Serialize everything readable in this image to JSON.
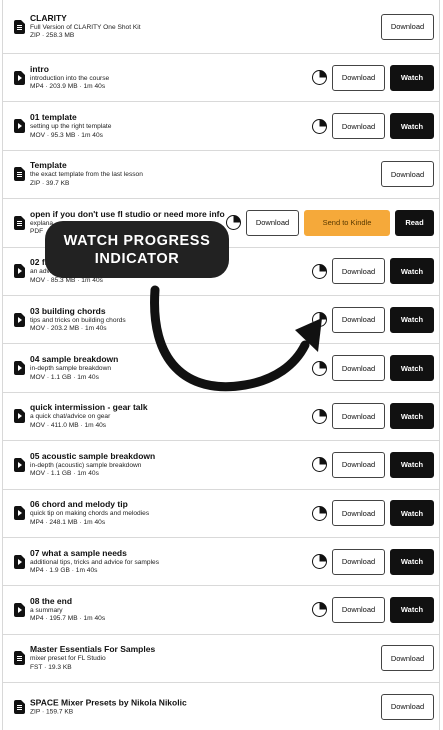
{
  "buttons": {
    "download": "Download",
    "watch": "Watch",
    "send_to_kindle": "Send to Kindle",
    "read": "Read"
  },
  "annotation": {
    "line1": "WATCH PROGRESS",
    "line2": "INDICATOR"
  },
  "colors": {
    "kindle_button": "#f5a93a",
    "annotation_bubble": "#222222",
    "watch_button": "#111111"
  },
  "items": [
    {
      "icon": "zip-file-icon",
      "title": "CLARITY",
      "desc": "Full Version of CLARITY One Shot Kit",
      "meta": "ZIP · 258.3 MB",
      "progress": false,
      "watch": false,
      "kindle": false
    },
    {
      "icon": "video-file-icon",
      "title": "intro",
      "desc": "introduction into the course",
      "meta": "MP4 · 203.9 MB · 1m 40s",
      "progress": true,
      "watch": true,
      "kindle": false
    },
    {
      "icon": "video-file-icon",
      "title": "01 template",
      "desc": "setting up the right template",
      "meta": "MOV · 95.3 MB · 1m 40s",
      "progress": true,
      "watch": true,
      "kindle": false
    },
    {
      "icon": "zip-file-icon",
      "title": "Template",
      "desc": "the exact template from the last lesson",
      "meta": "ZIP · 39.7 KB",
      "progress": false,
      "watch": false,
      "kindle": false
    },
    {
      "icon": "pdf-file-icon",
      "title": "open if you don't use fl studio or need more info",
      "desc": "explana",
      "meta": "PDF",
      "progress": true,
      "watch": false,
      "kindle": true
    },
    {
      "icon": "video-file-icon",
      "title": "02 fl",
      "desc": "an advi",
      "meta": "MOV · 85.3 MB · 1m 40s",
      "progress": true,
      "watch": true,
      "kindle": false
    },
    {
      "icon": "video-file-icon",
      "title": "03 building chords",
      "desc": "tips and tricks on building chords",
      "meta": "MOV · 203.2 MB · 1m 40s",
      "progress": true,
      "watch": true,
      "kindle": false
    },
    {
      "icon": "video-file-icon",
      "title": "04 sample breakdown",
      "desc": "in-depth sample breakdown",
      "meta": "MOV · 1.1 GB · 1m 40s",
      "progress": true,
      "watch": true,
      "kindle": false
    },
    {
      "icon": "video-file-icon",
      "title": "quick intermission - gear talk",
      "desc": "a quick chat/advice on gear",
      "meta": "MOV · 411.0 MB · 1m 40s",
      "progress": true,
      "watch": true,
      "kindle": false
    },
    {
      "icon": "video-file-icon",
      "title": "05 acoustic sample breakdown",
      "desc": "in-depth (acoustic) sample breakdown",
      "meta": "MOV · 1.1 GB · 1m 40s",
      "progress": true,
      "watch": true,
      "kindle": false
    },
    {
      "icon": "video-file-icon",
      "title": "06 chord and melody tip",
      "desc": "quick tip on making chords and melodies",
      "meta": "MP4 · 248.1 MB · 1m 40s",
      "progress": true,
      "watch": true,
      "kindle": false
    },
    {
      "icon": "video-file-icon",
      "title": "07 what a sample needs",
      "desc": "additional tips, tricks and advice for samples",
      "meta": "MP4 · 1.9 GB · 1m 40s",
      "progress": true,
      "watch": true,
      "kindle": false
    },
    {
      "icon": "video-file-icon",
      "title": "08 the end",
      "desc": "a summary",
      "meta": "MP4 · 195.7 MB · 1m 40s",
      "progress": true,
      "watch": true,
      "kindle": false
    },
    {
      "icon": "preset-file-icon",
      "title": "Master Essentials For Samples",
      "desc": "mixer preset for FL Studio",
      "meta": "FST · 19.3 KB",
      "progress": false,
      "watch": false,
      "kindle": false
    },
    {
      "icon": "zip-file-icon",
      "title": "SPACE Mixer Presets by Nikola Nikolic",
      "desc": "",
      "meta": "ZIP · 159.7 KB",
      "progress": false,
      "watch": false,
      "kindle": false
    }
  ]
}
